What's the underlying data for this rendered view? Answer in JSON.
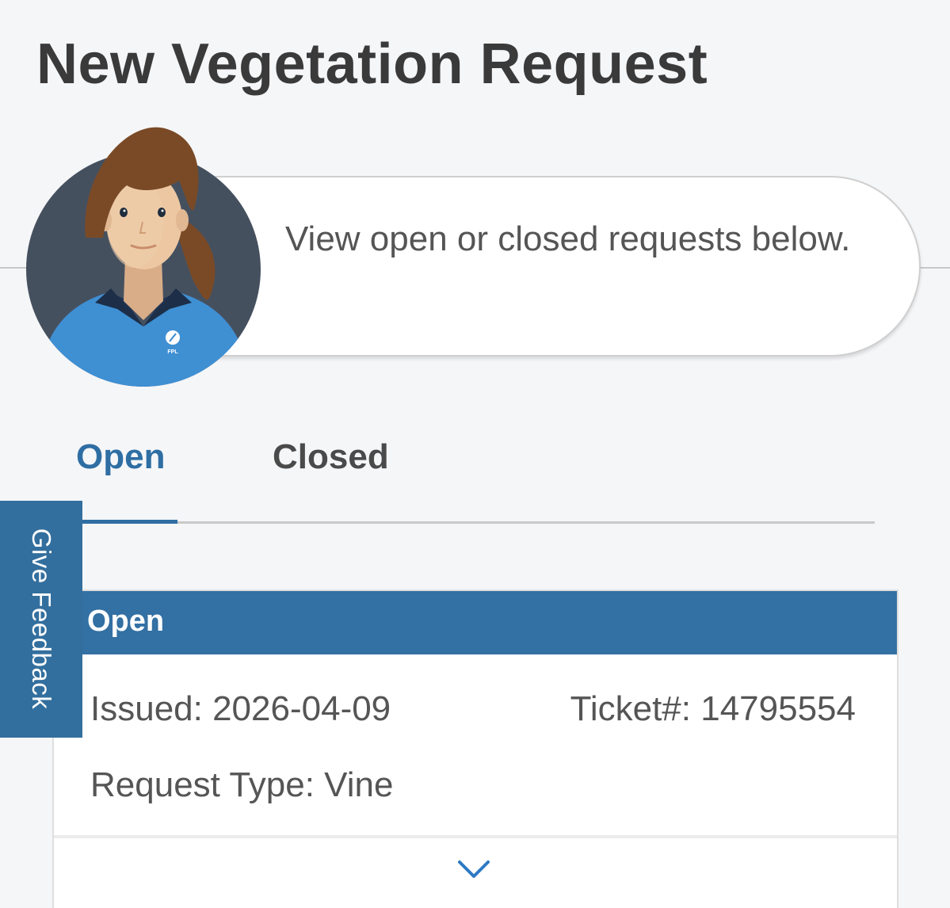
{
  "page": {
    "title": "New Vegetation Request"
  },
  "assistant": {
    "message": "View open or closed requests below.",
    "avatar_icon": "fpl-agent-avatar-icon",
    "badge_text": "FPL"
  },
  "tabs": [
    {
      "label": "Open",
      "active": true
    },
    {
      "label": "Closed",
      "active": false
    }
  ],
  "feedback": {
    "label": "Give Feedback"
  },
  "requests": [
    {
      "status": "Open",
      "issued": "Issued: 2026-04-09",
      "ticket": "Ticket#: 14795554",
      "request_type": "Request Type: Vine",
      "expand_icon": "chevron-down-icon"
    }
  ],
  "colors": {
    "accent": "#2e6ea3",
    "header_bar": "#3370a3",
    "feedback_tab": "#336f9e",
    "background": "#f5f6f8",
    "avatar_bg": "#45505f",
    "shirt": "#3f8fd3"
  }
}
